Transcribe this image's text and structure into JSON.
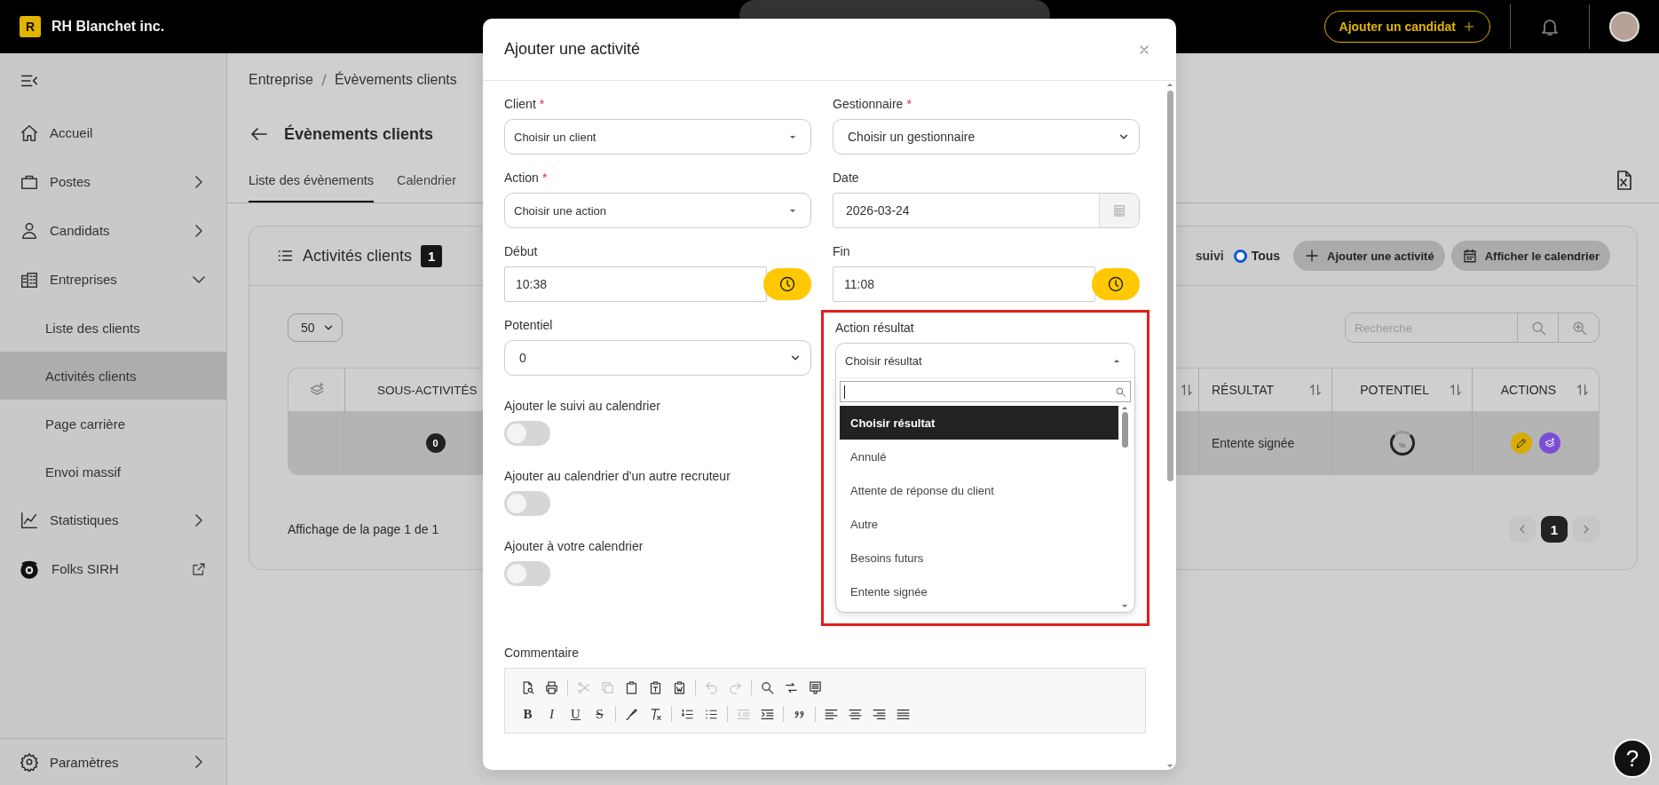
{
  "topbar": {
    "logo_letter": "R",
    "company": "RH Blanchet inc.",
    "add_candidate_button": "Ajouter un candidat"
  },
  "sidebar": {
    "items": [
      {
        "label": "Accueil",
        "kind": "link",
        "selected": false
      },
      {
        "label": "Postes",
        "kind": "group",
        "expanded": false,
        "selected": false
      },
      {
        "label": "Candidats",
        "kind": "group",
        "expanded": false,
        "selected": false
      },
      {
        "label": "Entreprises",
        "kind": "group",
        "expanded": true,
        "selected": false,
        "children": [
          {
            "label": "Liste des clients",
            "selected": false
          },
          {
            "label": "Activités clients",
            "selected": true
          },
          {
            "label": "Page carrière",
            "selected": false
          },
          {
            "label": "Envoi massif",
            "selected": false
          }
        ]
      },
      {
        "label": "Statistiques",
        "kind": "group",
        "expanded": false,
        "selected": false
      },
      {
        "label": "Folks SIRH",
        "kind": "external",
        "selected": false
      }
    ],
    "footer": {
      "label": "Paramètres",
      "kind": "group",
      "expanded": false,
      "selected": false
    }
  },
  "page": {
    "breadcrumb": [
      "Entreprise",
      "Évèvements clients"
    ],
    "title": "Évènements clients",
    "tabs": [
      {
        "label": "Liste des évènements",
        "selected": true
      },
      {
        "label": "Calendrier",
        "selected": false
      }
    ],
    "card": {
      "title": "Activités clients",
      "count": "1",
      "filter_partial": "suivi",
      "filter": {
        "label": "Tous",
        "selected": true
      },
      "buttons": [
        "Ajouter une activité",
        "Afficher le calendrier"
      ],
      "per_page": "50",
      "search": {
        "placeholder": "Recherche"
      },
      "columns_left": [
        "SOUS-ACTIVITÉS"
      ],
      "columns_right": [
        "RÉSULTAT",
        "POTENTIEL",
        "ACTIONS"
      ],
      "row": {
        "sub_count": "0",
        "result": "Entente signée",
        "potential": "%"
      },
      "page_info": "Affichage de la page 1 de 1",
      "pages": [
        {
          "label": "1",
          "selected": true
        }
      ]
    }
  },
  "modal": {
    "title": "Ajouter une activité",
    "fields": [
      {
        "label": "Client",
        "required_mark": "*",
        "kind": "combo",
        "value": "Choisir un client"
      },
      {
        "label": "Gestionnaire",
        "required_mark": "*",
        "kind": "select",
        "value": "Choisir un gestionnaire"
      },
      {
        "label": "Action",
        "required_mark": "*",
        "kind": "combo",
        "value": "Choisir une action"
      },
      {
        "label": "Date",
        "kind": "date",
        "value": "2026-03-24"
      },
      {
        "label": "Début",
        "kind": "time",
        "value": "10:38"
      },
      {
        "label": "Fin",
        "kind": "time",
        "value": "11:08"
      }
    ],
    "potential": {
      "label": "Potentiel",
      "value": "0"
    },
    "result": {
      "label": "Action résultat",
      "value": "Choisir résultat",
      "highlighted": true,
      "expanded": true,
      "options": [
        {
          "label": "Choisir résultat",
          "selected": true
        },
        {
          "label": "Annulé",
          "selected": false
        },
        {
          "label": "Attente de réponse du client",
          "selected": false
        },
        {
          "label": "Autre",
          "selected": false
        },
        {
          "label": "Besoins futurs",
          "selected": false
        },
        {
          "label": "Entente signée",
          "selected": false
        }
      ]
    },
    "toggles": [
      {
        "label": "Ajouter le suivi au calendrier",
        "on": false
      },
      {
        "label": "Ajouter au calendrier d'un autre recruteur",
        "on": false
      },
      {
        "label": "Ajouter à votre calendrier",
        "on": false
      }
    ],
    "comment": {
      "label": "Commentaire",
      "toolbar": [
        [
          [
            {
              "kind": "icon",
              "disabled": false
            },
            {
              "kind": "icon",
              "disabled": false
            }
          ],
          [
            {
              "kind": "icon",
              "disabled": true
            },
            {
              "kind": "icon",
              "disabled": true
            },
            {
              "kind": "icon",
              "disabled": false
            },
            {
              "kind": "icon",
              "disabled": false
            },
            {
              "kind": "icon",
              "disabled": false
            }
          ],
          [
            {
              "kind": "icon",
              "disabled": true
            },
            {
              "kind": "icon",
              "disabled": true
            }
          ],
          [
            {
              "kind": "icon",
              "disabled": false
            },
            {
              "kind": "icon",
              "disabled": false
            },
            {
              "kind": "icon",
              "disabled": false
            }
          ]
        ],
        [
          [
            {
              "kind": "bold",
              "label": "B"
            },
            {
              "kind": "italic",
              "label": "I"
            },
            {
              "kind": "underline",
              "label": "U"
            },
            {
              "kind": "strike",
              "label": "S"
            }
          ],
          [
            {
              "kind": "icon",
              "disabled": false
            },
            {
              "kind": "icon",
              "disabled": false
            }
          ],
          [
            {
              "kind": "icon",
              "disabled": false
            },
            {
              "kind": "icon",
              "disabled": false
            }
          ],
          [
            {
              "kind": "icon",
              "disabled": true
            },
            {
              "kind": "icon",
              "disabled": false
            }
          ],
          [
            {
              "kind": "icon",
              "disabled": false
            }
          ],
          [
            {
              "kind": "icon",
              "disabled": false
            },
            {
              "kind": "icon",
              "disabled": false
            },
            {
              "kind": "icon",
              "disabled": false
            },
            {
              "kind": "icon",
              "disabled": false
            }
          ]
        ]
      ]
    }
  },
  "help_button": "?"
}
